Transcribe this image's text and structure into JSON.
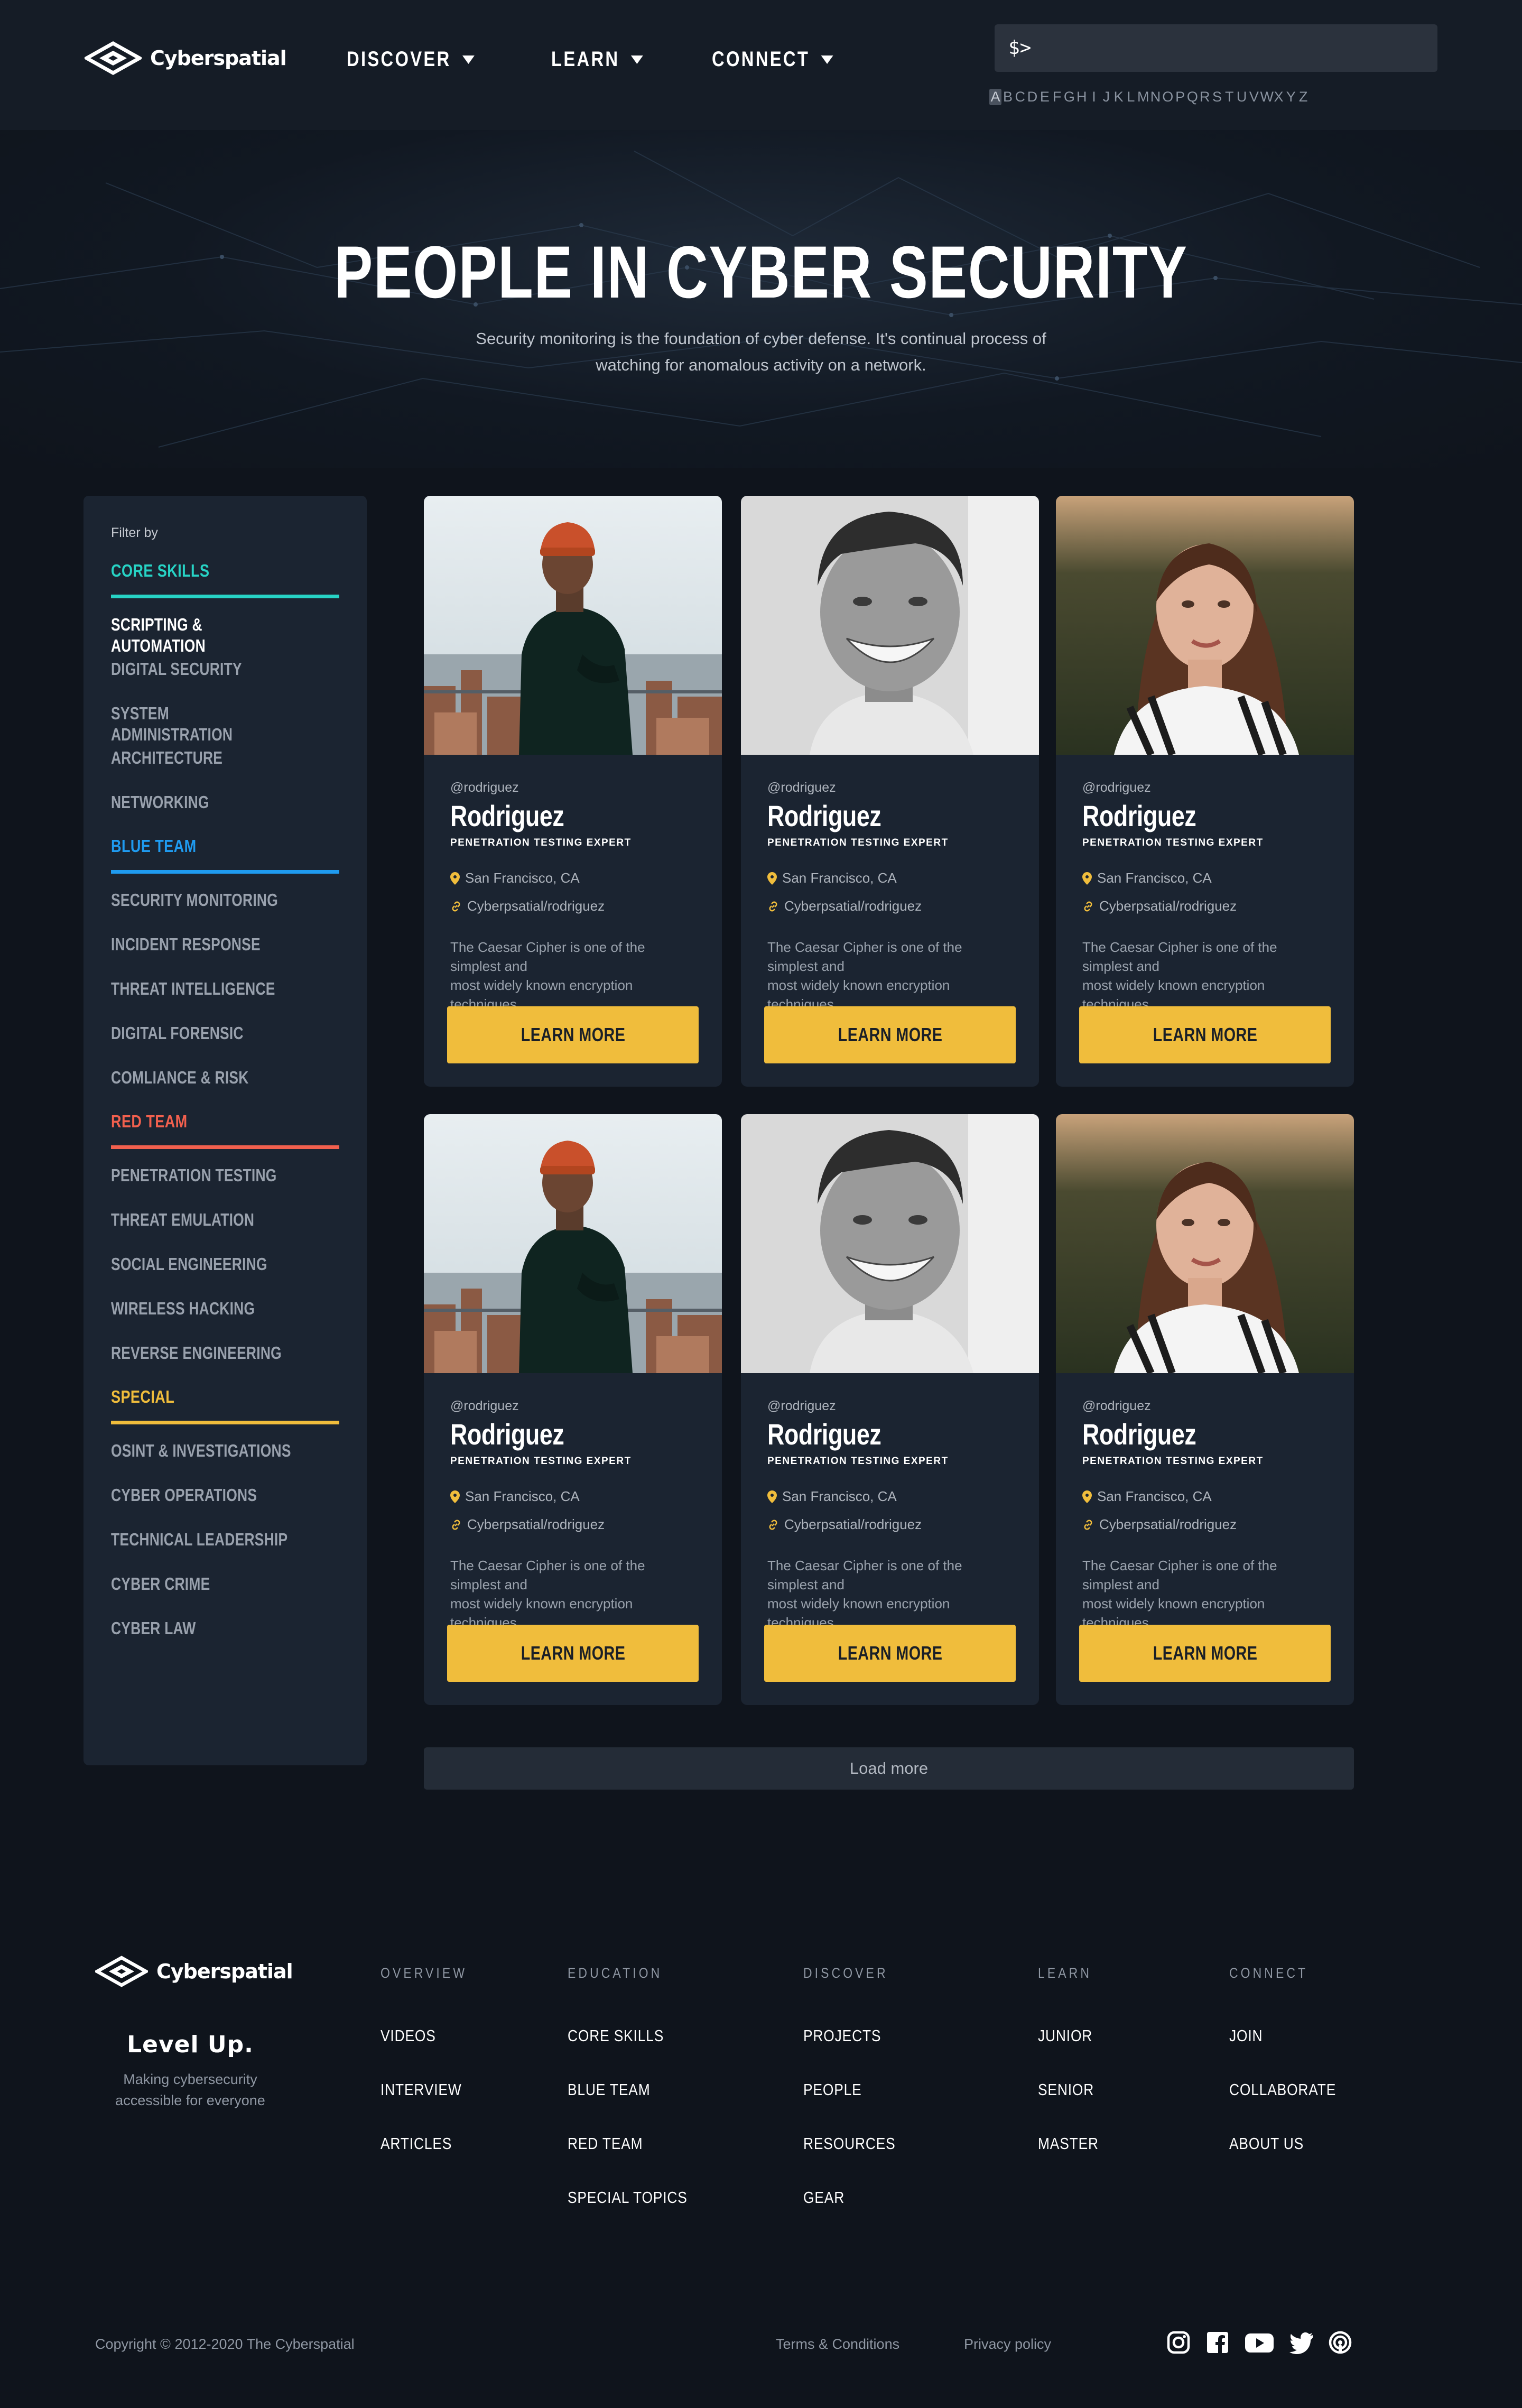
{
  "brand": {
    "name": "Cyberspatial"
  },
  "nav": {
    "items": [
      {
        "label": "DISCOVER"
      },
      {
        "label": "LEARN"
      },
      {
        "label": "CONNECT"
      }
    ],
    "search": {
      "prompt": "$>"
    },
    "alphabet": [
      "A",
      "B",
      "C",
      "D",
      "E",
      "F",
      "G",
      "H",
      "I",
      "J",
      "K",
      "L",
      "M",
      "N",
      "O",
      "P",
      "Q",
      "R",
      "S",
      "T",
      "U",
      "V",
      "W",
      "X",
      "Y",
      "Z"
    ],
    "alphabet_active": "A"
  },
  "hero": {
    "title": "PEOPLE IN CYBER SECURITY",
    "subtitle_line1": "Security monitoring is the foundation of cyber defense.  It's continual process of",
    "subtitle_line2": "watching for anomalous activity on a network."
  },
  "sidebar": {
    "filter_label": "Filter by",
    "groups": [
      {
        "title": "CORE SKILLS",
        "color": "#27d3c5",
        "items": [
          "SCRIPTING & AUTOMATION",
          "DIGITAL SECURITY",
          "SYSTEM ADMINISTRATION",
          "ARCHITECTURE",
          "NETWORKING"
        ]
      },
      {
        "title": "BLUE TEAM",
        "color": "#1f9bf0",
        "items": [
          "SECURITY MONITORING",
          "INCIDENT RESPONSE",
          "THREAT INTELLIGENCE",
          "DIGITAL FORENSIC",
          "COMLIANCE & RISK"
        ]
      },
      {
        "title": "RED TEAM",
        "color": "#f2604e",
        "items": [
          "PENETRATION TESTING",
          "THREAT EMULATION",
          "SOCIAL ENGINEERING",
          "WIRELESS HACKING",
          "REVERSE ENGINEERING"
        ]
      },
      {
        "title": "SPECIAL",
        "color": "#f0bd3c",
        "items": [
          "OSINT & INVESTIGATIONS",
          "CYBER OPERATIONS",
          "TECHNICAL LEADERSHIP",
          "CYBER CRIME",
          "CYBER LAW"
        ]
      }
    ],
    "active_item": "SCRIPTING & AUTOMATION"
  },
  "cards": [
    {
      "photo": "man-orange-beanie",
      "handle": "@rodriguez",
      "name": "Rodriguez",
      "role": "PENETRATION TESTING EXPERT",
      "location": "San Francisco, CA",
      "link": "Cyberpsatial/rodriguez",
      "desc_line1": "The Caesar Cipher is one of the simplest and",
      "desc_line2": "most widely known encryption techniques.",
      "button": "LEARN MORE"
    },
    {
      "photo": "man-smiling-bw",
      "handle": "@rodriguez",
      "name": "Rodriguez",
      "role": "PENETRATION TESTING EXPERT",
      "location": "San Francisco, CA",
      "link": "Cyberpsatial/rodriguez",
      "desc_line1": "The Caesar Cipher is one of the simplest and",
      "desc_line2": "most widely known encryption techniques.",
      "button": "LEARN MORE"
    },
    {
      "photo": "woman-striped-shirt",
      "handle": "@rodriguez",
      "name": "Rodriguez",
      "role": "PENETRATION TESTING EXPERT",
      "location": "San Francisco, CA",
      "link": "Cyberpsatial/rodriguez",
      "desc_line1": "The Caesar Cipher is one of the simplest and",
      "desc_line2": "most widely known encryption techniques.",
      "button": "LEARN MORE"
    },
    {
      "photo": "man-orange-beanie",
      "handle": "@rodriguez",
      "name": "Rodriguez",
      "role": "PENETRATION TESTING EXPERT",
      "location": "San Francisco, CA",
      "link": "Cyberpsatial/rodriguez",
      "desc_line1": "The Caesar Cipher is one of the simplest and",
      "desc_line2": "most widely known encryption techniques.",
      "button": "LEARN MORE"
    },
    {
      "photo": "man-smiling-bw",
      "handle": "@rodriguez",
      "name": "Rodriguez",
      "role": "PENETRATION TESTING EXPERT",
      "location": "San Francisco, CA",
      "link": "Cyberpsatial/rodriguez",
      "desc_line1": "The Caesar Cipher is one of the simplest and",
      "desc_line2": "most widely known encryption techniques.",
      "button": "LEARN MORE"
    },
    {
      "photo": "woman-striped-shirt",
      "handle": "@rodriguez",
      "name": "Rodriguez",
      "role": "PENETRATION TESTING EXPERT",
      "location": "San Francisco, CA",
      "link": "Cyberpsatial/rodriguez",
      "desc_line1": "The Caesar Cipher is one of the simplest and",
      "desc_line2": "most widely known encryption techniques.",
      "button": "LEARN MORE"
    }
  ],
  "load_more": "Load more",
  "footer": {
    "tagline": "Level Up.",
    "tagline_sub_line1": "Making cybersecurity",
    "tagline_sub_line2": "accessible for everyone",
    "columns": [
      {
        "title": "OVERVIEW",
        "links": [
          "VIDEOS",
          "INTERVIEW",
          "ARTICLES"
        ]
      },
      {
        "title": "EDUCATION",
        "links": [
          "CORE SKILLS",
          "BLUE TEAM",
          "RED TEAM",
          "SPECIAL TOPICS"
        ]
      },
      {
        "title": "DISCOVER",
        "links": [
          "PROJECTS",
          "PEOPLE",
          "RESOURCES",
          "GEAR"
        ]
      },
      {
        "title": "LEARN",
        "links": [
          "JUNIOR",
          "SENIOR",
          "MASTER"
        ]
      },
      {
        "title": "CONNECT",
        "links": [
          "JOIN",
          "COLLABORATE",
          "ABOUT US"
        ]
      }
    ],
    "copyright": "Copyright © 2012-2020 The Cyberspatial",
    "terms": "Terms & Conditions",
    "privacy": "Privacy policy",
    "social_icons": [
      "instagram-icon",
      "facebook-icon",
      "youtube-icon",
      "twitter-icon",
      "podcast-icon"
    ]
  },
  "colors": {
    "accent": "#f0bd3c",
    "bg": "#0f141c",
    "panel": "#1b2431"
  }
}
